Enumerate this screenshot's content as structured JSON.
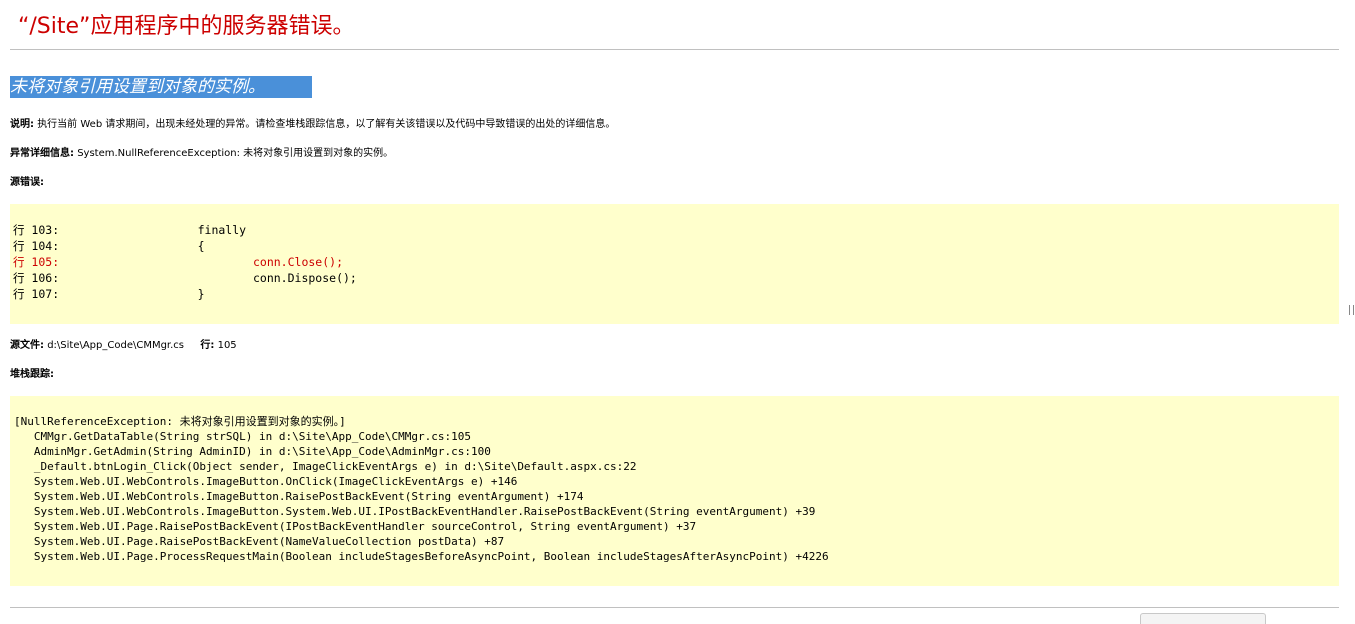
{
  "header": {
    "title": "“/Site”应用程序中的服务器错误。",
    "subtitle": "未将对象引用设置到对象的实例。"
  },
  "description": {
    "label": "说明:",
    "text": "执行当前 Web 请求期间，出现未经处理的异常。请检查堆栈跟踪信息，以了解有关该错误以及代码中导致错误的出处的详细信息。"
  },
  "exception_details": {
    "label": "异常详细信息:",
    "text": "System.NullReferenceException: 未将对象引用设置到对象的实例。"
  },
  "source_error": {
    "label": "源错误:",
    "lines": [
      {
        "num": "行 103:",
        "code": "                    finally",
        "error": false
      },
      {
        "num": "行 104:",
        "code": "                    {",
        "error": false
      },
      {
        "num": "行 105:",
        "code": "                            conn.Close();",
        "error": true
      },
      {
        "num": "行 106:",
        "code": "                            conn.Dispose();",
        "error": false
      },
      {
        "num": "行 107:",
        "code": "                    }",
        "error": false
      }
    ]
  },
  "source_file": {
    "label": "源文件:",
    "path": "d:\\Site\\App_Code\\CMMgr.cs",
    "line_label": "行:",
    "line": "105"
  },
  "stack_trace": {
    "label": "堆栈跟踪:",
    "lines": [
      "[NullReferenceException: 未将对象引用设置到对象的实例。]",
      "   CMMgr.GetDataTable(String strSQL) in d:\\Site\\App_Code\\CMMgr.cs:105",
      "   AdminMgr.GetAdmin(String AdminID) in d:\\Site\\App_Code\\AdminMgr.cs:100",
      "   _Default.btnLogin_Click(Object sender, ImageClickEventArgs e) in d:\\Site\\Default.aspx.cs:22",
      "   System.Web.UI.WebControls.ImageButton.OnClick(ImageClickEventArgs e) +146",
      "   System.Web.UI.WebControls.ImageButton.RaisePostBackEvent(String eventArgument) +174",
      "   System.Web.UI.WebControls.ImageButton.System.Web.UI.IPostBackEventHandler.RaisePostBackEvent(String eventArgument) +39",
      "   System.Web.UI.Page.RaisePostBackEvent(IPostBackEventHandler sourceControl, String eventArgument) +37",
      "   System.Web.UI.Page.RaisePostBackEvent(NameValueCollection postData) +87",
      "   System.Web.UI.Page.ProcessRequestMain(Boolean includeStagesBeforeAsyncPoint, Boolean includeStagesAfterAsyncPoint) +4226"
    ]
  },
  "colors": {
    "title": "#cc0000",
    "highlight": "#4a90d9",
    "code_background": "#ffffcc",
    "error_line": "#cc0000"
  }
}
